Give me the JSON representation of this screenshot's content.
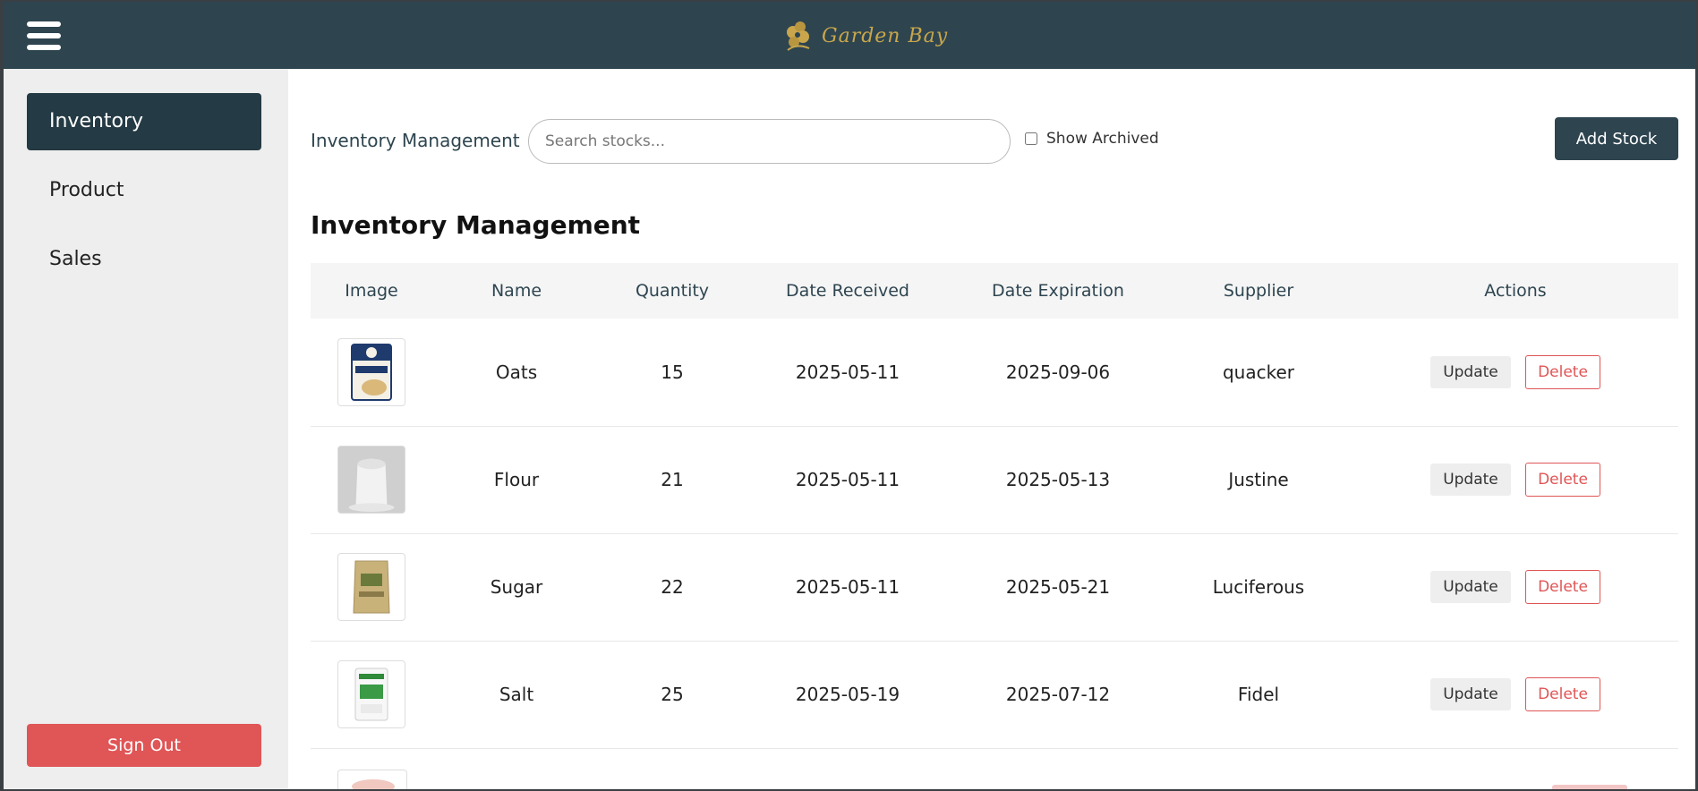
{
  "header": {
    "logo_text": "Garden Bay",
    "menu_icon": "hamburger-icon"
  },
  "sidebar": {
    "items": [
      {
        "label": "Inventory",
        "active": true
      },
      {
        "label": "Product",
        "active": false
      },
      {
        "label": "Sales",
        "active": false
      }
    ],
    "signout_label": "Sign Out"
  },
  "toolbar": {
    "title": "Inventory Management",
    "search_placeholder": "Search stocks...",
    "show_archived_label": "Show Archived",
    "add_stock_label": "Add Stock"
  },
  "page_title": "Inventory Management",
  "table": {
    "columns": [
      "Image",
      "Name",
      "Quantity",
      "Date Received",
      "Date Expiration",
      "Supplier",
      "Actions"
    ],
    "rows": [
      {
        "name": "Oats",
        "quantity": "15",
        "date_received": "2025-05-11",
        "date_expiration": "2025-09-06",
        "supplier": "quacker",
        "image_icon": "oats-package-image"
      },
      {
        "name": "Flour",
        "quantity": "21",
        "date_received": "2025-05-11",
        "date_expiration": "2025-05-13",
        "supplier": "Justine",
        "image_icon": "flour-sack-image"
      },
      {
        "name": "Sugar",
        "quantity": "22",
        "date_received": "2025-05-11",
        "date_expiration": "2025-05-21",
        "supplier": "Luciferous",
        "image_icon": "sugar-bag-image"
      },
      {
        "name": "Salt",
        "quantity": "25",
        "date_received": "2025-05-19",
        "date_expiration": "2025-07-12",
        "supplier": "Fidel",
        "image_icon": "salt-bag-image"
      }
    ],
    "update_label": "Update",
    "delete_label": "Delete"
  },
  "colors": {
    "header_bg": "#2e4550",
    "sidebar_active_bg": "#243a44",
    "danger": "#e05556",
    "logo_gold": "#c9a64b"
  }
}
